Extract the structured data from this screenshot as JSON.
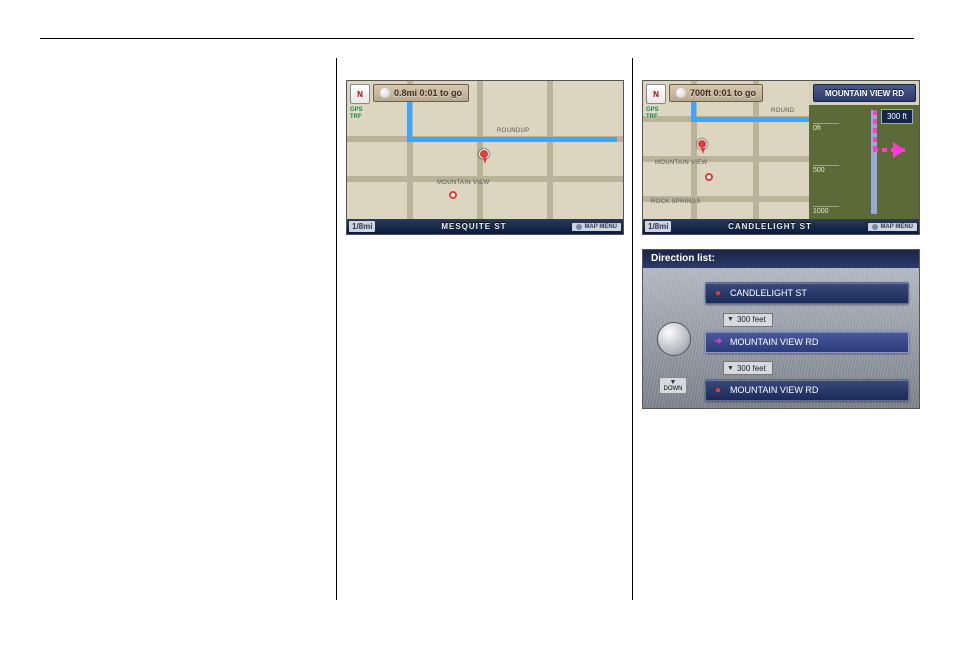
{
  "map_left": {
    "compass": "N",
    "gps_badge_line1": "GPS",
    "gps_badge_line2": "TRF",
    "eta": "0.8mi 0:01 to go",
    "scale": "1/8mi",
    "current_street": "MESQUITE ST",
    "map_menu": "MAP MENU",
    "labels": {
      "roundup": "ROUNDUP",
      "mountain_view": "MOUNTAIN VIEW"
    }
  },
  "map_right": {
    "compass": "N",
    "gps_badge_line1": "GPS",
    "gps_badge_line2": "TRF",
    "eta": "700ft 0:01 to go",
    "next_road": "MOUNTAIN VIEW RD",
    "scale": "1/8mi",
    "current_street": "CANDLELIGHT ST",
    "map_menu": "MAP MENU",
    "labels": {
      "round": "ROUND",
      "mountain_view": "MOUNTAIN VIEW",
      "rock_springs": "ROCK SPRINGS"
    },
    "guidance": {
      "distance_chip": "300 ft",
      "scale_0": "0ft",
      "scale_500": "500",
      "scale_1000": "1000"
    }
  },
  "direction_list": {
    "title": "Direction list:",
    "down_label": "DOWN",
    "rows": [
      {
        "icon": "●",
        "icon_color": "#e63b3b",
        "label": "CANDLELIGHT ST"
      },
      {
        "type": "dist",
        "label": "300 feet"
      },
      {
        "icon": "➜",
        "icon_color": "#ff3bd4",
        "label": "MOUNTAIN VIEW RD",
        "highlight": true
      },
      {
        "type": "dist",
        "label": "300 feet"
      },
      {
        "icon": "●",
        "icon_color": "#e63b3b",
        "label": "MOUNTAIN VIEW RD"
      }
    ]
  }
}
